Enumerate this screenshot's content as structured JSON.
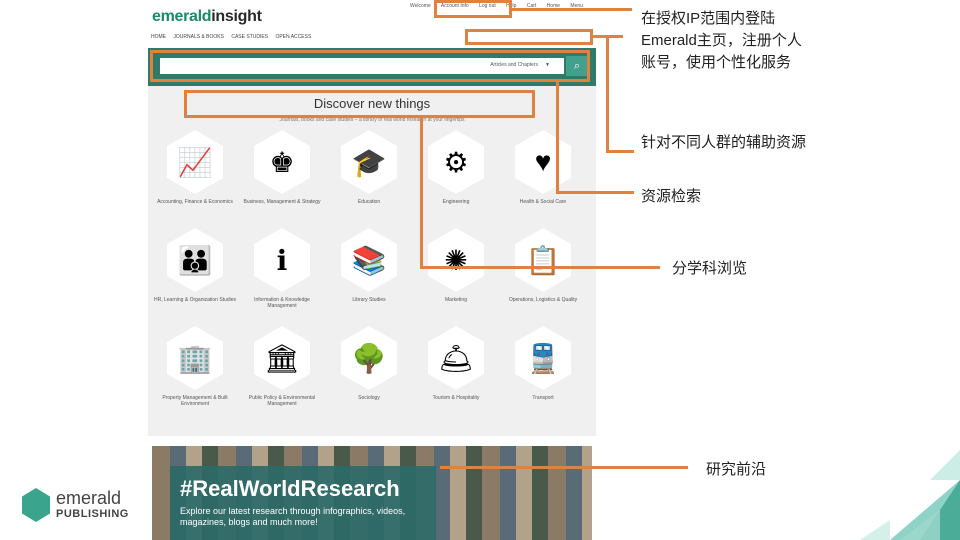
{
  "site": {
    "logo_a": "emerald",
    "logo_b": "insight",
    "top_links": [
      "Welcome",
      "Account Info",
      "Log out",
      "Help",
      "Cart",
      "Home",
      "Menu"
    ],
    "nav": [
      "HOME",
      "JOURNALS & BOOKS",
      "CASE STUDIES",
      "OPEN ACCESS"
    ],
    "search_select": "Articles and Chapters",
    "search_icon": "search-icon",
    "discover_title": "Discover new things",
    "discover_sub": "Journals, books and case studies – a library of real world research at your fingertips",
    "subjects": [
      {
        "label": "Accounting, Finance & Economics",
        "icon": "chart-icon"
      },
      {
        "label": "Business, Management & Strategy",
        "icon": "chess-icon"
      },
      {
        "label": "Education",
        "icon": "graduation-cap-icon"
      },
      {
        "label": "Engineering",
        "icon": "gears-icon"
      },
      {
        "label": "Health & Social Care",
        "icon": "heart-hands-icon"
      },
      {
        "label": "HR, Learning & Organization Studies",
        "icon": "people-icon"
      },
      {
        "label": "Information & Knowledge Management",
        "icon": "info-icon"
      },
      {
        "label": "Library Studies",
        "icon": "books-icon"
      },
      {
        "label": "Marketing",
        "icon": "dandelion-icon"
      },
      {
        "label": "Operations, Logistics & Quality",
        "icon": "clipboard-icon"
      },
      {
        "label": "Property Management & Built Environment",
        "icon": "buildings-icon"
      },
      {
        "label": "Public Policy & Environmental Management",
        "icon": "capitol-icon"
      },
      {
        "label": "Sociology",
        "icon": "tree-icon"
      },
      {
        "label": "Tourism & Hospitality",
        "icon": "cloche-icon"
      },
      {
        "label": "Transport",
        "icon": "train-icon"
      }
    ],
    "banner_title": "#RealWorldResearch",
    "banner_sub": "Explore our latest research through infographics, videos, magazines, blogs and much more!"
  },
  "annotations": {
    "login": "在授权IP范围内登陆Emerald主页，注册个人账号，使用个性化服务",
    "audience": "针对不同人群的辅助资源",
    "search": "资源检索",
    "subject_browse": "分学科浏览",
    "frontier": "研究前沿"
  },
  "brand": {
    "word1": "emerald",
    "word2": "PUBLISHING"
  },
  "colors": {
    "highlight": "#e0813e",
    "brand_green": "#2f7a6a"
  }
}
